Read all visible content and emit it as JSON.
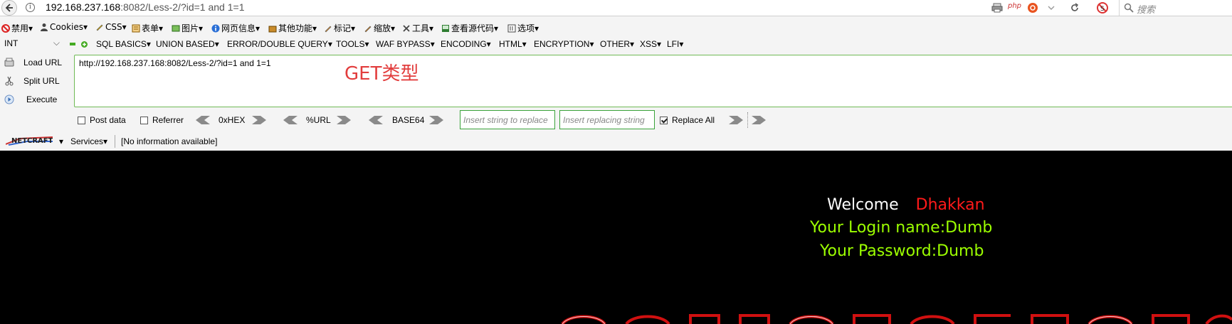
{
  "urlbar": {
    "url_host": "192.168.237.168",
    "url_rest": ":8082/Less-2/?id=1 and 1=1",
    "search_placeholder": "搜索",
    "php_label": "php"
  },
  "menubar": {
    "items": [
      "禁用",
      "Cookies",
      "CSS",
      "表单",
      "图片",
      "网页信息",
      "其他功能",
      "标记",
      "缩放",
      "工具",
      "查看源代码",
      "选项"
    ]
  },
  "hackbar": {
    "select_value": "INT",
    "items": [
      "SQL BASICS",
      "UNION BASED",
      "ERROR/DOUBLE QUERY",
      "TOOLS",
      "WAF BYPASS",
      "ENCODING",
      "HTML",
      "ENCRYPTION",
      "OTHER",
      "XSS",
      "LFI"
    ],
    "load_url": "Load URL",
    "split_url": "Split URL",
    "execute": "Execute",
    "url_value": "http://192.168.237.168:8082/Less-2/?id=1 and 1=1",
    "annotation": "GET类型",
    "post_data": "Post data",
    "referrer": "Referrer",
    "hex": "0xHEX",
    "urlenc": "%URL",
    "base64": "BASE64",
    "insert_placeholder": "Insert string to replace",
    "replacing_placeholder": "Insert replacing string",
    "replace_all": "Replace All"
  },
  "netcraft": {
    "services": "Services",
    "info": "[No information available]"
  },
  "page": {
    "welcome": "Welcome",
    "name": "Dhakkan",
    "login": "Your Login name:Dumb",
    "password": "Your Password:Dumb"
  },
  "colors": {
    "login_green": "#9cff00",
    "name_red": "#ff1a1a",
    "annotation_red": "#e23d3d",
    "hackbar_border": "#6fba55"
  }
}
